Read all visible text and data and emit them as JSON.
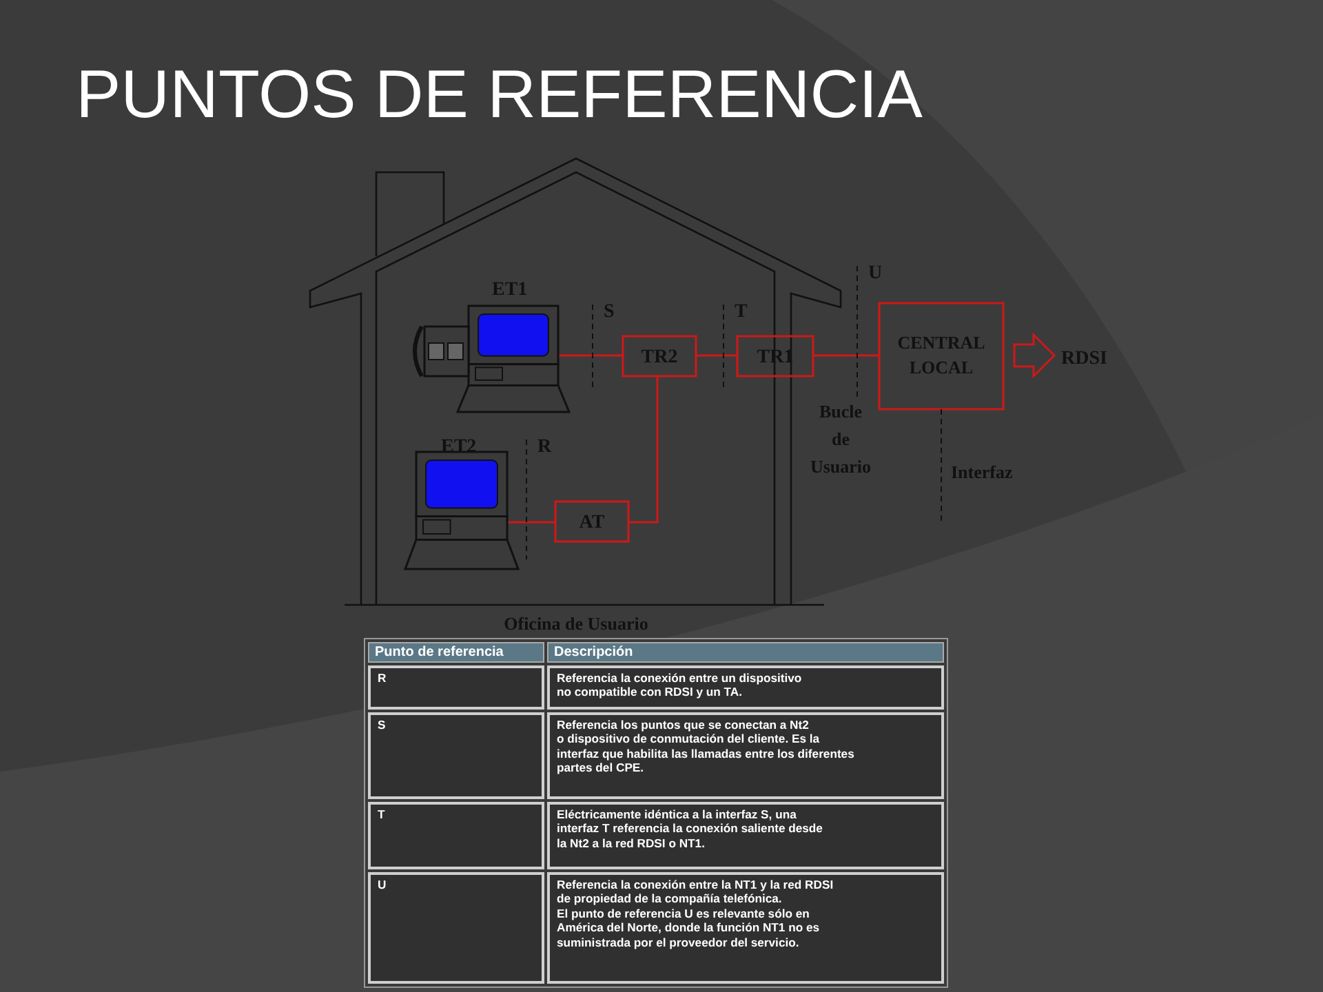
{
  "title": "PUNTOS DE REFERENCIA",
  "diagram": {
    "terminals": [
      {
        "label": "ET1",
        "phone": true
      },
      {
        "label": "ET2",
        "phone": false
      }
    ],
    "reference_points": [
      {
        "label": "S"
      },
      {
        "label": "T"
      },
      {
        "label": "U"
      },
      {
        "label": "R"
      }
    ],
    "devices": [
      {
        "label": "TR2"
      },
      {
        "label": "TR1"
      },
      {
        "label": "AT"
      }
    ],
    "central": "CENTRAL\nLOCAL",
    "network": "RDSI",
    "loop_label": "Bucle\nde\nUsuario",
    "interface_label": "Interfaz",
    "office_label": "Oficina de Usuario"
  },
  "table": {
    "columns": [
      "Punto de referencia",
      "Descripción"
    ],
    "rows": [
      {
        "point": "R",
        "description": "Referencia la conexión entre un dispositivo\nno compatible con RDSI y un TA."
      },
      {
        "point": "S",
        "description": "Referencia los puntos que se conectan a Nt2\no dispositivo de conmutación del cliente. Es la\ninterfaz que habilita las llamadas entre los diferentes\npartes del CPE."
      },
      {
        "point": "T",
        "description": "Eléctricamente idéntica a la interfaz S, una\ninterfaz T referencia la conexión saliente desde\nla Nt2 a la red RDSI o NT1."
      },
      {
        "point": "U",
        "description": "Referencia la conexión entre la NT1 y la red RDSI\nde propiedad de la compañía telefónica.\nEl punto de referencia U es relevante sólo en\nAmérica del Norte, donde la función NT1 no es\nsuministrada por el proveedor del servicio."
      }
    ]
  }
}
